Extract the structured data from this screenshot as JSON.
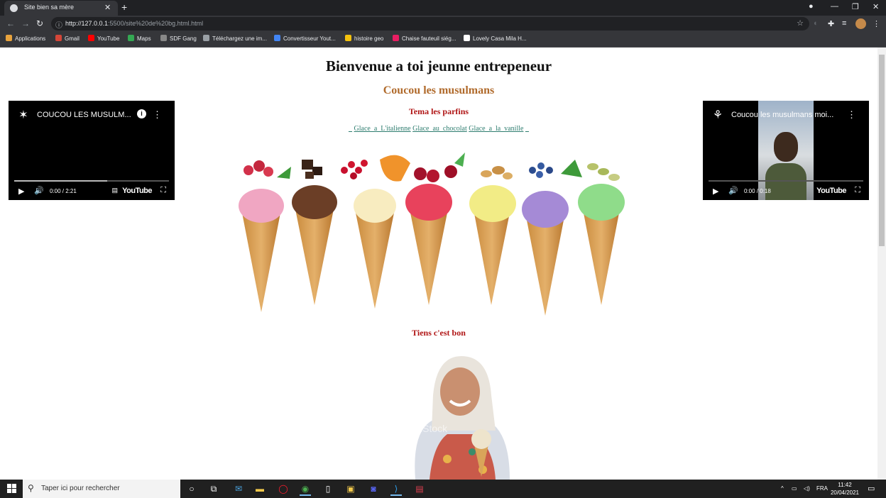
{
  "browser": {
    "tab_title": "Site bien sa mère",
    "tab_close": "✕",
    "new_tab": "+",
    "url_host": "http://127.0.0.1",
    "url_path": ":5500/site%20de%20bg.html.html",
    "bookmarks": [
      {
        "label": "Applications",
        "color": "#e8a33d"
      },
      {
        "label": "Gmail",
        "color": "#d44638"
      },
      {
        "label": "YouTube",
        "color": "#ff0000"
      },
      {
        "label": "Maps",
        "color": "#34a853"
      },
      {
        "label": "SDF Gang",
        "color": "#888888"
      },
      {
        "label": "Téléchargez une im...",
        "color": "#9aa0a6"
      },
      {
        "label": "Convertisseur Yout...",
        "color": "#4285f4"
      },
      {
        "label": "histoire geo",
        "color": "#f4c20d"
      },
      {
        "label": "Chaise fauteuil siég...",
        "color": "#e91e63"
      },
      {
        "label": "Lovely Casa Mila H...",
        "color": "#ffffff"
      }
    ]
  },
  "page": {
    "title": "Bienvenue a toi jeunne entrepeneur",
    "subtitle": "Coucou les musulmans",
    "section1": "Tema les parfins",
    "links": [
      "Glace_a_L'italienne",
      "Glace_au_chocolat",
      "Glace_a_la_vanille"
    ],
    "link_prefix": "_",
    "link_suffix": "_",
    "section2": "Tiens c'est bon",
    "video_left": {
      "title": "COUCOU LES MUSULM...",
      "time": "0:00 / 2:21",
      "brand": "YouTube",
      "progress": 0.6
    },
    "video_right": {
      "title": "Coucou les musulmans moi...",
      "time": "0:00 / 0:18",
      "brand": "YouTube",
      "progress": 0.0
    },
    "watermark": "iStock"
  },
  "taskbar": {
    "search_placeholder": "Taper ici pour rechercher",
    "lang": "FRA",
    "time": "11:42",
    "date": "20/04/2021"
  },
  "colors": {
    "title": "#111111",
    "subtitle": "#b06a2b",
    "section": "#b01515",
    "link": "#2e7d6f"
  }
}
